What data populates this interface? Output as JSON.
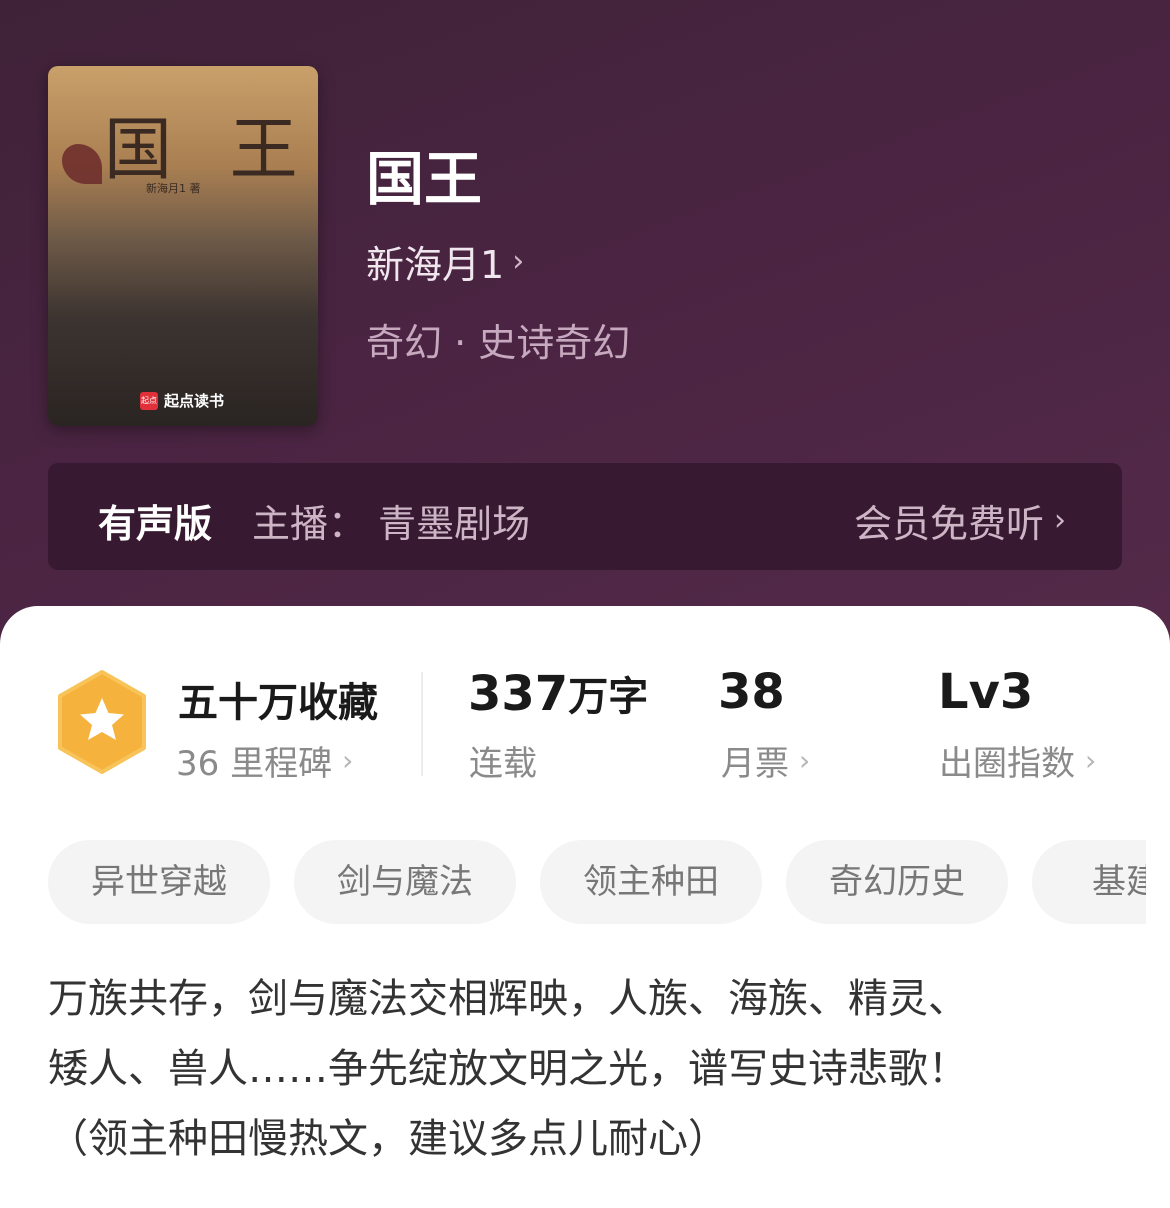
{
  "book": {
    "cover": {
      "title": "国 王",
      "author": "新海月1 著",
      "brand": "起点读书",
      "brand_logo": "起点"
    },
    "title": "国王",
    "author": "新海月1",
    "genre": "奇幻 · 史诗奇幻"
  },
  "audio": {
    "label": "有声版",
    "host": "主播：  青墨剧场",
    "vip": "会员免费听"
  },
  "stats": {
    "collect": {
      "value": "五十万收藏",
      "sub": "36 里程碑"
    },
    "words": {
      "value": "337",
      "unit": "万字",
      "sub": "连载"
    },
    "tickets": {
      "value": "38",
      "sub": "月票"
    },
    "level": {
      "value": "Lv3",
      "sub": "出圈指数"
    }
  },
  "tags": [
    "异世穿越",
    "剑与魔法",
    "领主种田",
    "奇幻历史",
    "基建流"
  ],
  "description": [
    "万族共存，剑与魔法交相辉映，人族、海族、精灵、",
    "矮人、兽人……争先绽放文明之光，谱写史诗悲歌！",
    "（领主种田慢热文，建议多点儿耐心）"
  ],
  "colors": {
    "hero_bg": "#4a2442",
    "audio_bg": "#371a31",
    "badge": "#f5b23c"
  },
  "icons": {
    "chevron": "chevron-right-icon",
    "badge": "star-badge-icon"
  }
}
